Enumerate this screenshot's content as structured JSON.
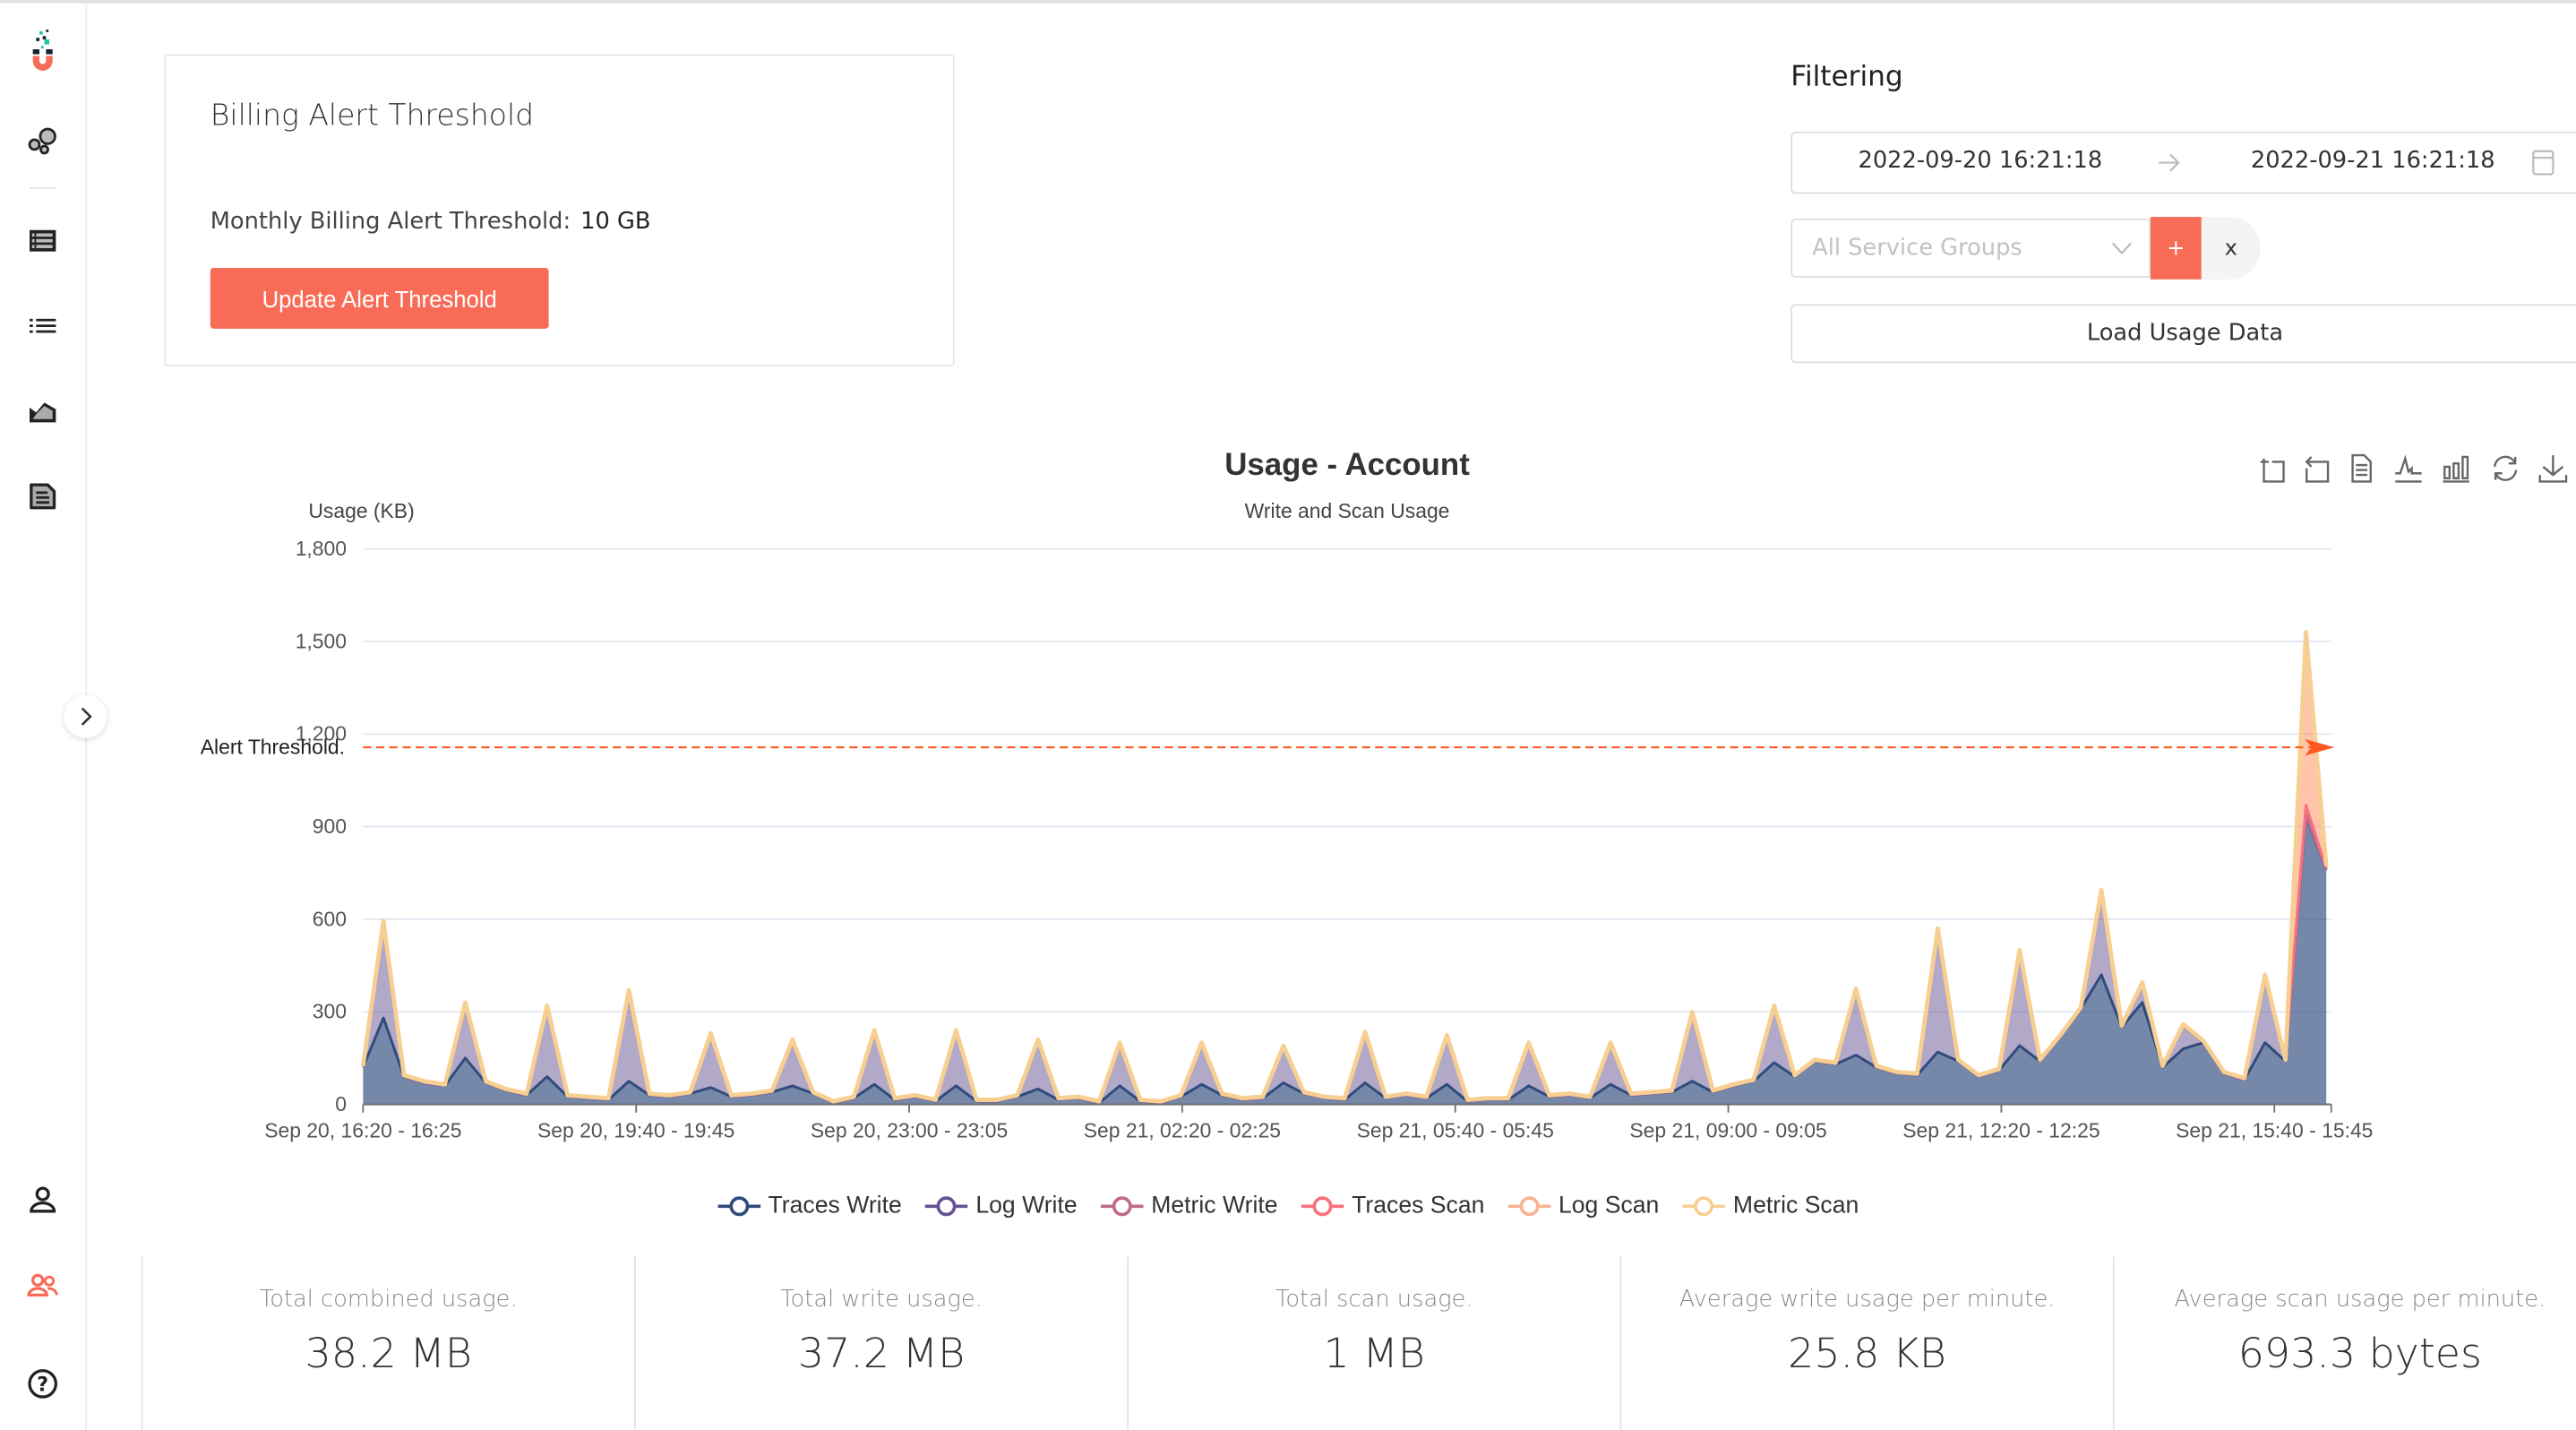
{
  "sidebar": {
    "icons": [
      "logo-magnet",
      "services-bubbles",
      "table-list",
      "list",
      "area-chart",
      "document",
      "user",
      "team",
      "help"
    ],
    "accent": "#f86c57"
  },
  "billing": {
    "title": "Billing Alert Threshold",
    "threshold_label": "Monthly Billing Alert Threshold:",
    "threshold_value": "10 GB",
    "update_button": "Update Alert Threshold"
  },
  "filtering": {
    "title": "Filtering",
    "start_date": "2022-09-20 16:21:18",
    "end_date": "2022-09-21 16:21:18",
    "service_groups_placeholder": "All Service Groups",
    "add_label": "+",
    "clear_label": "x",
    "load_button": "Load Usage Data"
  },
  "chart_data": {
    "type": "area",
    "stacked": true,
    "title": "Usage - Account",
    "subtitle": "Write and Scan Usage",
    "ylabel": "Usage (KB)",
    "ylim": [
      0,
      1800
    ],
    "yticks": [
      "0",
      "300",
      "600",
      "900",
      "1,200",
      "1,500",
      "1,800"
    ],
    "ytick_values": [
      0,
      300,
      600,
      900,
      1200,
      1500,
      1800
    ],
    "grid": true,
    "legend_position": "bottom",
    "xtick_labels": [
      "Sep 20, 16:20 - 16:25",
      "Sep 20, 19:40 - 19:45",
      "Sep 20, 23:00 - 23:05",
      "Sep 21, 02:20 - 02:25",
      "Sep 21, 05:40 - 05:45",
      "Sep 21, 09:00 - 09:05",
      "Sep 21, 12:20 - 12:25",
      "Sep 21, 15:40 - 15:45"
    ],
    "x_range": [
      "Sep 20, 16:20",
      "Sep 21, 16:20"
    ],
    "alert_threshold": {
      "label": "Alert Threshold.",
      "value": 1157,
      "color": "#ff5722"
    },
    "series": [
      {
        "name": "Traces Write",
        "color": "#2f4b7c",
        "values": [
          120,
          280,
          90,
          70,
          60,
          150,
          70,
          45,
          30,
          90,
          25,
          20,
          15,
          75,
          30,
          25,
          35,
          55,
          25,
          30,
          40,
          60,
          35,
          5,
          20,
          65,
          15,
          25,
          10,
          60,
          10,
          10,
          25,
          50,
          15,
          20,
          5,
          60,
          10,
          5,
          25,
          65,
          30,
          15,
          20,
          70,
          35,
          20,
          15,
          70,
          20,
          30,
          20,
          65,
          10,
          15,
          15,
          60,
          25,
          30,
          20,
          65,
          30,
          35,
          40,
          75,
          40,
          60,
          75,
          135,
          90,
          140,
          130,
          160,
          120,
          100,
          95,
          170,
          140,
          90,
          110,
          190,
          140,
          220,
          310,
          420,
          250,
          330,
          120,
          180,
          200,
          100,
          80,
          200,
          140,
          930,
          760
        ]
      },
      {
        "name": "Log Write",
        "color": "#665191",
        "values": [
          0,
          310,
          0,
          0,
          0,
          175,
          0,
          0,
          0,
          225,
          0,
          0,
          0,
          290,
          0,
          0,
          0,
          170,
          0,
          0,
          0,
          145,
          0,
          0,
          0,
          170,
          0,
          0,
          0,
          175,
          0,
          0,
          0,
          155,
          0,
          0,
          0,
          135,
          0,
          0,
          0,
          130,
          0,
          0,
          0,
          115,
          0,
          0,
          0,
          160,
          0,
          0,
          0,
          155,
          0,
          0,
          0,
          135,
          0,
          0,
          0,
          130,
          0,
          0,
          0,
          220,
          0,
          0,
          0,
          180,
          0,
          0,
          0,
          210,
          0,
          0,
          0,
          395,
          0,
          0,
          0,
          305,
          0,
          0,
          0,
          270,
          0,
          60,
          0,
          75,
          0,
          0,
          0,
          215,
          0,
          0,
          0
        ]
      },
      {
        "name": "Metric Write",
        "color": "#a05195",
        "values": [
          2,
          2,
          2,
          2,
          2,
          2,
          2,
          2,
          2,
          2,
          2,
          2,
          2,
          2,
          2,
          2,
          2,
          2,
          2,
          2,
          2,
          2,
          2,
          2,
          2,
          2,
          2,
          2,
          2,
          2,
          2,
          2,
          2,
          2,
          2,
          2,
          2,
          2,
          2,
          2,
          2,
          2,
          2,
          2,
          2,
          2,
          2,
          2,
          2,
          2,
          2,
          2,
          2,
          2,
          2,
          2,
          2,
          2,
          2,
          2,
          2,
          2,
          2,
          2,
          2,
          2,
          2,
          2,
          2,
          2,
          2,
          2,
          2,
          2,
          2,
          2,
          2,
          2,
          2,
          2,
          2,
          2,
          2,
          2,
          2,
          2,
          2,
          2,
          2,
          2,
          2,
          2,
          2,
          2,
          2,
          10,
          5
        ]
      },
      {
        "name": "Traces Scan",
        "color": "#f95d6a",
        "values": [
          0,
          0,
          0,
          0,
          0,
          0,
          0,
          0,
          0,
          0,
          0,
          0,
          0,
          0,
          0,
          0,
          0,
          0,
          0,
          0,
          0,
          0,
          0,
          0,
          0,
          0,
          0,
          0,
          0,
          0,
          0,
          0,
          0,
          0,
          0,
          0,
          0,
          0,
          0,
          0,
          0,
          0,
          0,
          0,
          0,
          0,
          0,
          0,
          0,
          0,
          0,
          0,
          0,
          0,
          0,
          0,
          0,
          0,
          0,
          0,
          0,
          0,
          0,
          0,
          0,
          0,
          0,
          0,
          0,
          0,
          0,
          0,
          0,
          0,
          0,
          0,
          0,
          0,
          0,
          0,
          0,
          0,
          0,
          0,
          0,
          0,
          0,
          0,
          0,
          0,
          0,
          0,
          0,
          0,
          0,
          30,
          0
        ]
      },
      {
        "name": "Log Scan",
        "color": "#ff7c43",
        "values": [
          0,
          0,
          0,
          0,
          0,
          0,
          0,
          0,
          0,
          0,
          0,
          0,
          0,
          0,
          0,
          0,
          0,
          0,
          0,
          0,
          0,
          0,
          0,
          0,
          0,
          0,
          0,
          0,
          0,
          0,
          0,
          0,
          0,
          0,
          0,
          0,
          0,
          0,
          0,
          0,
          0,
          0,
          0,
          0,
          0,
          0,
          0,
          0,
          0,
          0,
          0,
          0,
          0,
          0,
          0,
          0,
          0,
          0,
          0,
          0,
          0,
          0,
          0,
          0,
          0,
          0,
          0,
          0,
          0,
          0,
          0,
          0,
          0,
          0,
          0,
          0,
          0,
          0,
          0,
          0,
          0,
          0,
          0,
          0,
          0,
          0,
          0,
          0,
          0,
          0,
          0,
          0,
          0,
          0,
          0,
          555,
          5
        ]
      },
      {
        "name": "Metric Scan",
        "color": "#ffa600",
        "values": [
          3,
          3,
          3,
          3,
          3,
          3,
          3,
          3,
          3,
          3,
          3,
          3,
          3,
          3,
          3,
          3,
          3,
          3,
          3,
          3,
          3,
          3,
          3,
          3,
          3,
          3,
          3,
          3,
          3,
          3,
          3,
          3,
          3,
          3,
          3,
          3,
          3,
          3,
          3,
          3,
          3,
          3,
          3,
          3,
          3,
          3,
          3,
          3,
          3,
          3,
          3,
          3,
          3,
          3,
          3,
          3,
          3,
          3,
          3,
          3,
          3,
          3,
          3,
          3,
          3,
          3,
          3,
          3,
          3,
          3,
          3,
          3,
          3,
          3,
          3,
          3,
          3,
          3,
          3,
          3,
          3,
          3,
          3,
          3,
          3,
          3,
          3,
          3,
          3,
          3,
          3,
          3,
          3,
          3,
          3,
          5,
          3
        ]
      }
    ]
  },
  "toolbar": {
    "icons": [
      "zoom-select",
      "zoom-reset",
      "data-view",
      "line-chart",
      "bar-chart",
      "restore",
      "save-image"
    ]
  },
  "stats": [
    {
      "label": "Total combined usage.",
      "value": "38.2 MB"
    },
    {
      "label": "Total write usage.",
      "value": "37.2 MB"
    },
    {
      "label": "Total scan usage.",
      "value": "1 MB"
    },
    {
      "label": "Average write usage per minute.",
      "value": "25.8 KB"
    },
    {
      "label": "Average scan usage per minute.",
      "value": "693.3 bytes"
    }
  ]
}
